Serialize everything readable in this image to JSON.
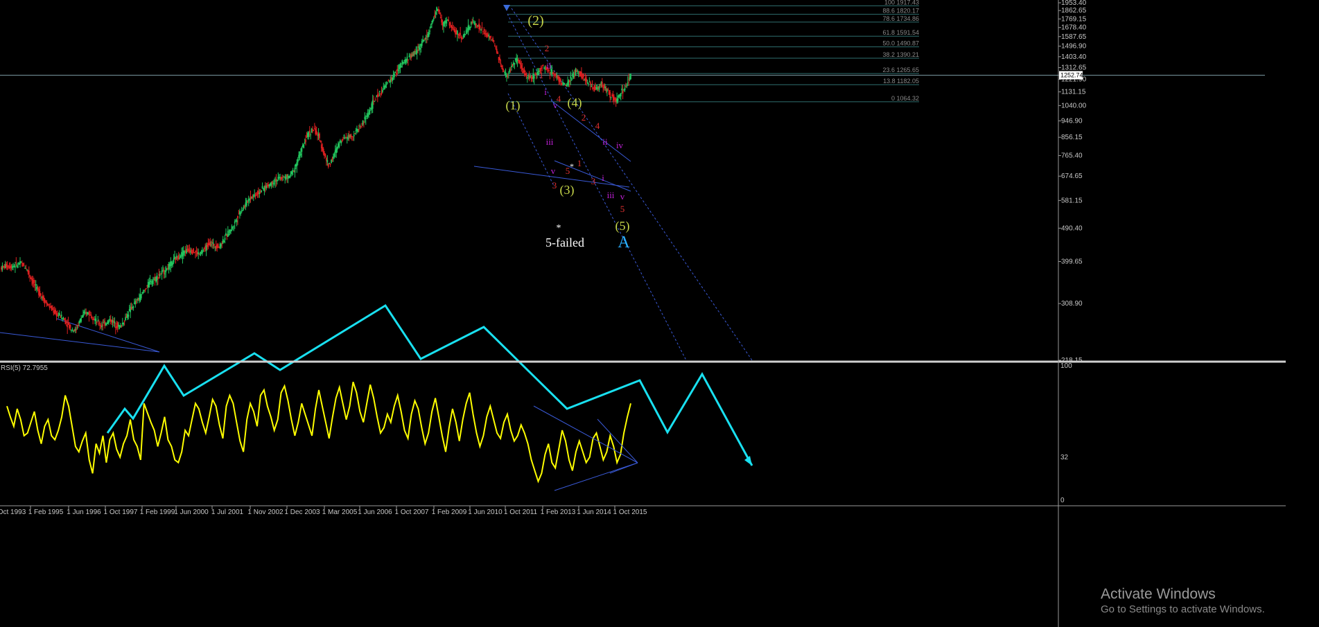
{
  "chart_data": {
    "type": "candlestick",
    "instrument_price_scale": {
      "ticks": [
        "1953.40",
        "1862.65",
        "1769.15",
        "1678.40",
        "1587.65",
        "1496.90",
        "1403.40",
        "1312.65",
        "1221.90",
        "1131.15",
        "1040.00",
        "946.90",
        "856.15",
        "765.40",
        "674.65",
        "581.15",
        "490.40",
        "399.65",
        "308.90",
        "218.15"
      ],
      "current_price": "1252.74",
      "range": [
        218.15,
        1953.4
      ]
    },
    "time_axis_labels": [
      "Oct 1993",
      "1 Feb 1995",
      "1 Jun 1996",
      "1 Oct 1997",
      "1 Feb 1999",
      "1 Jun 2000",
      "1 Jul 2001",
      "1 Nov 2002",
      "1 Dec 2003",
      "1 Mar 2005",
      "1 Jun 2006",
      "1 Oct 2007",
      "1 Feb 2009",
      "1 Jun 2010",
      "1 Oct 2011",
      "1 Feb 2013",
      "1 Jun 2014",
      "1 Oct 2015"
    ],
    "price_path": [
      [
        0,
        385
      ],
      [
        1,
        390
      ],
      [
        2,
        388
      ],
      [
        3,
        392
      ],
      [
        4,
        395
      ],
      [
        5,
        384
      ],
      [
        6,
        360
      ],
      [
        7,
        340
      ],
      [
        8,
        325
      ],
      [
        9,
        310
      ],
      [
        10,
        300
      ],
      [
        11,
        290
      ],
      [
        12,
        286
      ],
      [
        13,
        276
      ],
      [
        14,
        265
      ],
      [
        15,
        262
      ],
      [
        16,
        282
      ],
      [
        17,
        292
      ],
      [
        18,
        291
      ],
      [
        19,
        278
      ],
      [
        20,
        270
      ],
      [
        21,
        274
      ],
      [
        22,
        280
      ],
      [
        23,
        272
      ],
      [
        24,
        268
      ],
      [
        25,
        282
      ],
      [
        26,
        298
      ],
      [
        27,
        310
      ],
      [
        28,
        322
      ],
      [
        29,
        338
      ],
      [
        30,
        352
      ],
      [
        31,
        360
      ],
      [
        32,
        370
      ],
      [
        33,
        378
      ],
      [
        34,
        390
      ],
      [
        35,
        406
      ],
      [
        36,
        415
      ],
      [
        37,
        426
      ],
      [
        38,
        430
      ],
      [
        39,
        424
      ],
      [
        40,
        418
      ],
      [
        41,
        432
      ],
      [
        42,
        448
      ],
      [
        43,
        442
      ],
      [
        44,
        438
      ],
      [
        45,
        462
      ],
      [
        46,
        480
      ],
      [
        47,
        505
      ],
      [
        48,
        540
      ],
      [
        49,
        560
      ],
      [
        50,
        590
      ],
      [
        51,
        600
      ],
      [
        52,
        612
      ],
      [
        53,
        628
      ],
      [
        54,
        640
      ],
      [
        55,
        655
      ],
      [
        56,
        665
      ],
      [
        57,
        668
      ],
      [
        58,
        672
      ],
      [
        59,
        700
      ],
      [
        60,
        760
      ],
      [
        61,
        820
      ],
      [
        62,
        880
      ],
      [
        63,
        900
      ],
      [
        64,
        860
      ],
      [
        65,
        780
      ],
      [
        66,
        720
      ],
      [
        67,
        760
      ],
      [
        68,
        820
      ],
      [
        69,
        860
      ],
      [
        70,
        860
      ],
      [
        71,
        870
      ],
      [
        72,
        900
      ],
      [
        73,
        940
      ],
      [
        74,
        990
      ],
      [
        75,
        1060
      ],
      [
        76,
        1110
      ],
      [
        77,
        1150
      ],
      [
        78,
        1200
      ],
      [
        79,
        1240
      ],
      [
        80,
        1300
      ],
      [
        81,
        1350
      ],
      [
        82,
        1390
      ],
      [
        83,
        1420
      ],
      [
        84,
        1470
      ],
      [
        85,
        1540
      ],
      [
        86,
        1600
      ],
      [
        87,
        1740
      ],
      [
        88,
        1900
      ],
      [
        89,
        1700
      ],
      [
        90,
        1760
      ],
      [
        91,
        1660
      ],
      [
        92,
        1620
      ],
      [
        93,
        1580
      ],
      [
        94,
        1650
      ],
      [
        95,
        1740
      ],
      [
        96,
        1700
      ],
      [
        97,
        1650
      ],
      [
        98,
        1600
      ],
      [
        99,
        1560
      ],
      [
        100,
        1440
      ],
      [
        101,
        1300
      ],
      [
        102,
        1240
      ],
      [
        103,
        1330
      ],
      [
        104,
        1380
      ],
      [
        105,
        1300
      ],
      [
        106,
        1250
      ],
      [
        107,
        1230
      ],
      [
        108,
        1270
      ],
      [
        109,
        1320
      ],
      [
        110,
        1300
      ],
      [
        111,
        1280
      ],
      [
        112,
        1240
      ],
      [
        113,
        1200
      ],
      [
        114,
        1170
      ],
      [
        115,
        1230
      ],
      [
        116,
        1290
      ],
      [
        117,
        1260
      ],
      [
        118,
        1200
      ],
      [
        119,
        1180
      ],
      [
        120,
        1150
      ],
      [
        121,
        1190
      ],
      [
        122,
        1150
      ],
      [
        123,
        1100
      ],
      [
        124,
        1070
      ],
      [
        125,
        1120
      ],
      [
        126,
        1170
      ],
      [
        127,
        1250
      ]
    ],
    "fib_levels": [
      {
        "label": "100 1917.43",
        "price": 1917.43
      },
      {
        "label": "88.6 1820.17",
        "price": 1820.17
      },
      {
        "label": "78.6 1734.86",
        "price": 1734.86
      },
      {
        "label": "61.8 1591.54",
        "price": 1591.54
      },
      {
        "label": "50.0 1490.87",
        "price": 1490.87
      },
      {
        "label": "38.2 1390.21",
        "price": 1390.21
      },
      {
        "label": "23.6 1265.65",
        "price": 1265.65
      },
      {
        "label": "13.8 1182.05",
        "price": 1182.05
      },
      {
        "label": "0 1064.32",
        "price": 1064.32
      }
    ],
    "wave_labels": [
      {
        "text": "(2)",
        "color": "#c8d84a"
      },
      {
        "text": "(1)",
        "color": "#c8d84a"
      },
      {
        "text": "(4)",
        "color": "#c8d84a"
      },
      {
        "text": "(3)",
        "color": "#c8d84a"
      },
      {
        "text": "(5)",
        "color": "#c8d84a"
      },
      {
        "text": "A",
        "color": "#2ab0ff"
      },
      {
        "text": "2",
        "color": "#e03030"
      },
      {
        "text": "1",
        "color": "#e03030"
      },
      {
        "text": "4",
        "color": "#e03030"
      },
      {
        "text": "2",
        "color": "#e03030"
      },
      {
        "text": "4",
        "color": "#e03030"
      },
      {
        "text": "5",
        "color": "#e03030"
      },
      {
        "text": "1",
        "color": "#e03030"
      },
      {
        "text": "3",
        "color": "#e03030"
      },
      {
        "text": "3",
        "color": "#e03030"
      },
      {
        "text": "5",
        "color": "#e03030"
      },
      {
        "text": "ii",
        "color": "#c020d8"
      },
      {
        "text": "i",
        "color": "#c020d8"
      },
      {
        "text": "v",
        "color": "#c020d8"
      },
      {
        "text": "iii",
        "color": "#c020d8"
      },
      {
        "text": "v",
        "color": "#c020d8"
      },
      {
        "text": "ii",
        "color": "#c020d8"
      },
      {
        "text": "iv",
        "color": "#c020d8"
      },
      {
        "text": "i",
        "color": "#c020d8"
      },
      {
        "text": "iii",
        "color": "#c020d8"
      },
      {
        "text": "v",
        "color": "#c020d8"
      },
      {
        "text": "*",
        "color": "#ffffff"
      },
      {
        "text": "*",
        "color": "#ffffff"
      },
      {
        "text": "5-failed",
        "color": "#ffffff"
      }
    ],
    "rsi": {
      "label": "RSI(5) 72.7955",
      "scale_ticks": [
        "100",
        "32",
        "0"
      ],
      "values": [
        70,
        62,
        55,
        68,
        60,
        48,
        50,
        58,
        66,
        52,
        42,
        55,
        60,
        48,
        45,
        52,
        62,
        78,
        70,
        55,
        40,
        36,
        44,
        50,
        30,
        20,
        42,
        35,
        48,
        28,
        45,
        50,
        38,
        32,
        42,
        48,
        60,
        45,
        40,
        30,
        72,
        65,
        58,
        52,
        40,
        50,
        62,
        45,
        40,
        30,
        28,
        36,
        52,
        48,
        60,
        72,
        68,
        58,
        50,
        62,
        75,
        70,
        56,
        46,
        70,
        78,
        72,
        58,
        44,
        36,
        60,
        72,
        66,
        55,
        78,
        82,
        70,
        62,
        52,
        60,
        80,
        85,
        74,
        60,
        48,
        58,
        72,
        64,
        56,
        48,
        68,
        82,
        70,
        58,
        46,
        62,
        76,
        84,
        72,
        60,
        70,
        88,
        80,
        66,
        58,
        72,
        86,
        76,
        62,
        50,
        54,
        64,
        58,
        70,
        78,
        66,
        52,
        46,
        64,
        74,
        68,
        54,
        42,
        50,
        66,
        76,
        62,
        48,
        36,
        54,
        68,
        58,
        44,
        60,
        72,
        80,
        64,
        50,
        40,
        48,
        62,
        70,
        60,
        50,
        46,
        58,
        64,
        52,
        44,
        48,
        56,
        50,
        42,
        30,
        22,
        14,
        20,
        34,
        42,
        28,
        24,
        38,
        52,
        44,
        30,
        22,
        36,
        44,
        36,
        28,
        32,
        46,
        50,
        40,
        30,
        36,
        48,
        40,
        28,
        34,
        50,
        62,
        72
      ]
    },
    "colors": {
      "up_candle": "#22c55e",
      "down_candle": "#e02020",
      "fib_line": "#2f6f6f",
      "trend_line": "#3a5ad8",
      "projection": "#19e0f0",
      "rsi_line": "#ffff00",
      "grid_separator": "#d0d0d0"
    }
  },
  "watermark": {
    "title": "Activate Windows",
    "subtitle": "Go to Settings to activate Windows."
  }
}
